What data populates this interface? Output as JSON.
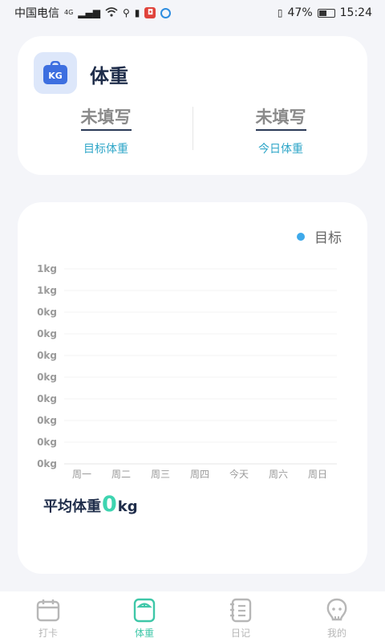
{
  "status_bar": {
    "carrier": "中国电信",
    "network": "4G",
    "battery": "47%",
    "time": "15:24"
  },
  "weight_card": {
    "icon_text": "KG",
    "title": "体重",
    "target": {
      "value": "未填写",
      "label": "目标体重"
    },
    "today": {
      "value": "未填写",
      "label": "今日体重"
    }
  },
  "chart_card": {
    "legend": "目标",
    "average": {
      "label": "平均体重",
      "value": "0",
      "unit": "kg"
    }
  },
  "chart_data": {
    "type": "line",
    "categories": [
      "周一",
      "周二",
      "周三",
      "周四",
      "今天",
      "周六",
      "周日"
    ],
    "y_tick_labels": [
      "1kg",
      "1kg",
      "0kg",
      "0kg",
      "0kg",
      "0kg",
      "0kg",
      "0kg",
      "0kg",
      "0kg"
    ],
    "series": [
      {
        "name": "目标",
        "values": [
          null,
          null,
          null,
          null,
          null,
          null,
          null
        ]
      }
    ],
    "grid": true,
    "legend_position": "top-right"
  },
  "bottom_nav": [
    {
      "label": "打卡",
      "icon": "calendar-icon",
      "active": false
    },
    {
      "label": "体重",
      "icon": "scale-icon",
      "active": true
    },
    {
      "label": "日记",
      "icon": "notebook-icon",
      "active": false
    },
    {
      "label": "我的",
      "icon": "profile-icon",
      "active": false
    }
  ],
  "colors": {
    "accent": "#3ec7a8",
    "legend_dot": "#3ea9ea",
    "label_blue": "#2ea6c8",
    "title": "#1f2d4a"
  }
}
